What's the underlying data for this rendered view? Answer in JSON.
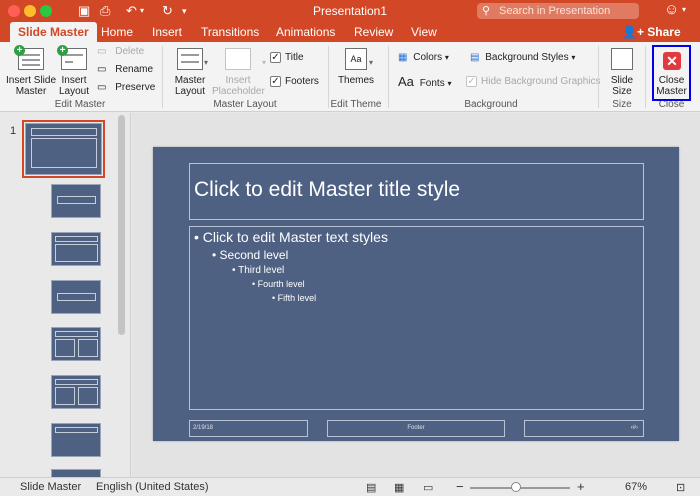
{
  "window": {
    "title": "Presentation1",
    "search_placeholder": "Search in Presentation"
  },
  "tabs": [
    {
      "label": "Slide Master",
      "active": true
    },
    {
      "label": "Home"
    },
    {
      "label": "Insert"
    },
    {
      "label": "Transitions"
    },
    {
      "label": "Animations"
    },
    {
      "label": "Review"
    },
    {
      "label": "View"
    }
  ],
  "share_label": "Share",
  "ribbon": {
    "edit_master": {
      "insert_slide_master": "Insert Slide Master",
      "insert_layout": "Insert Layout",
      "delete": "Delete",
      "rename": "Rename",
      "preserve": "Preserve",
      "group_label": "Edit Master"
    },
    "master_layout": {
      "master_layout": "Master Layout",
      "insert_placeholder": "Insert Placeholder",
      "title_check": "Title",
      "footers_check": "Footers",
      "group_label": "Master Layout"
    },
    "edit_theme": {
      "themes": "Themes",
      "group_label": "Edit Theme"
    },
    "background": {
      "colors": "Colors",
      "fonts": "Fonts",
      "background_styles": "Background Styles",
      "hide_background_graphics": "Hide Background Graphics",
      "group_label": "Background"
    },
    "size": {
      "slide_size": "Slide Size",
      "group_label": "Size"
    },
    "close": {
      "close_master": "Close Master",
      "group_label": "Close"
    }
  },
  "thumbnails": {
    "master_number": "1"
  },
  "slide": {
    "title": "Click to edit Master title style",
    "levels": [
      "• Click to edit Master text styles",
      "• Second level",
      "• Third level",
      "• Fourth level",
      "• Fifth level"
    ],
    "footer_date": "2/19/18",
    "footer_text": "Footer",
    "footer_number": "‹#›"
  },
  "status": {
    "view_name": "Slide Master",
    "language": "English (United States)",
    "zoom": "67%"
  },
  "colors": {
    "brand": "#d24726",
    "slide_bg": "#4f6183",
    "close_highlight": "#0000ee"
  },
  "icons": [
    "close-window-icon",
    "minimize-icon",
    "zoom-icon",
    "save-icon",
    "print-icon",
    "undo-icon",
    "redo-icon",
    "search-icon",
    "smiley-icon",
    "share-icon"
  ]
}
